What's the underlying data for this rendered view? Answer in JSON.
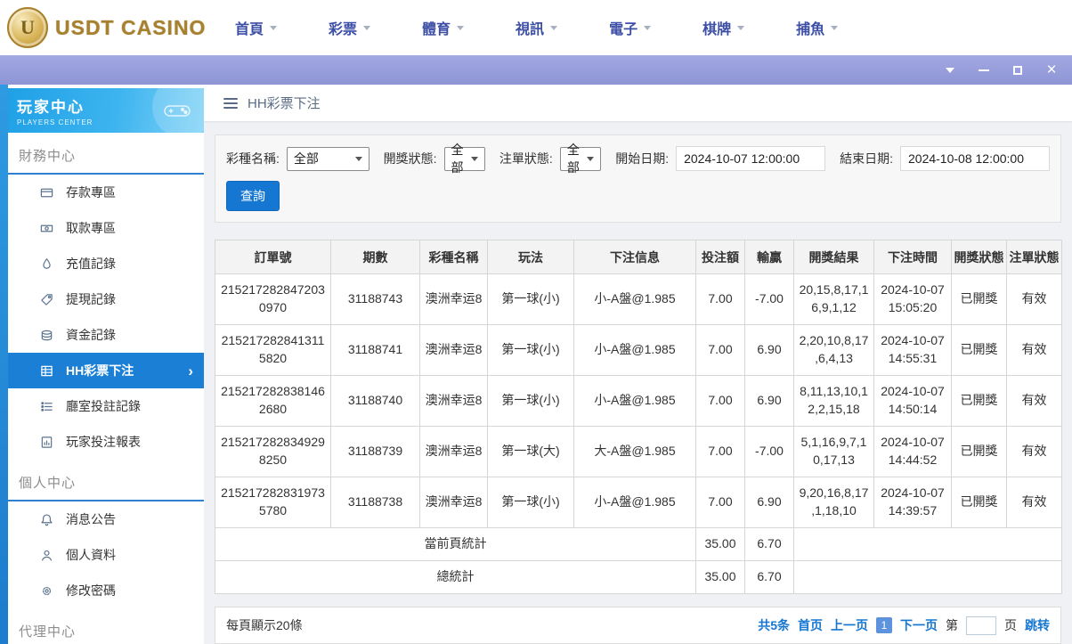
{
  "brand": {
    "name": "USDT CASINO",
    "coin_letter": "U"
  },
  "top_nav": {
    "caret_icon": "chevron-down-icon",
    "items": [
      {
        "label": "首頁"
      },
      {
        "label": "彩票"
      },
      {
        "label": "體育"
      },
      {
        "label": "視訊"
      },
      {
        "label": "電子"
      },
      {
        "label": "棋牌"
      },
      {
        "label": "捕魚"
      }
    ]
  },
  "window_controls": {
    "icons": [
      "collapse-chevron",
      "minimize",
      "maximize",
      "close"
    ],
    "close_glyph": "×"
  },
  "sidebar": {
    "header": {
      "title": "玩家中心",
      "subtitle": "PLAYERS CENTER",
      "icon": "gamepad-icon"
    },
    "sections": [
      {
        "title": "財務中心",
        "items": [
          {
            "label": "存款專區",
            "icon": "deposit-icon"
          },
          {
            "label": "取款專區",
            "icon": "withdraw-icon"
          },
          {
            "label": "充值記錄",
            "icon": "recharge-icon"
          },
          {
            "label": "提現記錄",
            "icon": "cashout-icon"
          },
          {
            "label": "資金記錄",
            "icon": "funds-icon"
          },
          {
            "label": "HH彩票下注",
            "icon": "lottery-icon",
            "active": true,
            "arrow": "›"
          },
          {
            "label": "廳室投註記錄",
            "icon": "hall-records-icon"
          },
          {
            "label": "玩家投注報表",
            "icon": "report-icon"
          }
        ]
      },
      {
        "title": "個人中心",
        "items": [
          {
            "label": "消息公告",
            "icon": "bell-icon"
          },
          {
            "label": "個人資料",
            "icon": "user-icon"
          },
          {
            "label": "修改密碼",
            "icon": "gear-icon"
          }
        ]
      },
      {
        "title": "代理中心",
        "items": []
      }
    ]
  },
  "breadcrumb": {
    "title": "HH彩票下注",
    "icon": "hamburger-icon"
  },
  "filters": {
    "lottery_label": "彩種名稱:",
    "lottery_value": "全部",
    "draw_status_label": "開獎狀態:",
    "draw_status_value": "全部",
    "order_status_label": "注單狀態:",
    "order_status_value": "全部",
    "start_label": "開始日期:",
    "start_value": "2024-10-07 12:00:00",
    "end_label": "結束日期:",
    "end_value": "2024-10-08 12:00:00",
    "search_label": "查詢"
  },
  "table": {
    "headers": [
      "訂單號",
      "期數",
      "彩種名稱",
      "玩法",
      "下注信息",
      "投注額",
      "輸贏",
      "開獎結果",
      "下注時間",
      "開獎狀態",
      "注單狀態"
    ],
    "rows": [
      {
        "order_no": "2152172828472030970",
        "period": "31188743",
        "lottery": "澳洲幸运8",
        "play": "第一球(小)",
        "bet_info": "小-A盤@1.985",
        "amount": "7.00",
        "win": "-7.00",
        "result": "20,15,8,17,16,9,1,12",
        "time": "2024-10-07 15:05:20",
        "draw_status": "已開獎",
        "order_status": "有效"
      },
      {
        "order_no": "2152172828413115820",
        "period": "31188741",
        "lottery": "澳洲幸运8",
        "play": "第一球(小)",
        "bet_info": "小-A盤@1.985",
        "amount": "7.00",
        "win": "6.90",
        "result": "2,20,10,8,17,6,4,13",
        "time": "2024-10-07 14:55:31",
        "draw_status": "已開獎",
        "order_status": "有效"
      },
      {
        "order_no": "2152172828381462680",
        "period": "31188740",
        "lottery": "澳洲幸运8",
        "play": "第一球(小)",
        "bet_info": "小-A盤@1.985",
        "amount": "7.00",
        "win": "6.90",
        "result": "8,11,13,10,12,2,15,18",
        "time": "2024-10-07 14:50:14",
        "draw_status": "已開獎",
        "order_status": "有效"
      },
      {
        "order_no": "2152172828349298250",
        "period": "31188739",
        "lottery": "澳洲幸运8",
        "play": "第一球(大)",
        "bet_info": "大-A盤@1.985",
        "amount": "7.00",
        "win": "-7.00",
        "result": "5,1,16,9,7,10,17,13",
        "time": "2024-10-07 14:44:52",
        "draw_status": "已開獎",
        "order_status": "有效"
      },
      {
        "order_no": "2152172828319735780",
        "period": "31188738",
        "lottery": "澳洲幸运8",
        "play": "第一球(小)",
        "bet_info": "小-A盤@1.985",
        "amount": "7.00",
        "win": "6.90",
        "result": "9,20,16,8,17,1,18,10",
        "time": "2024-10-07 14:39:57",
        "draw_status": "已開獎",
        "order_status": "有效"
      }
    ],
    "page_total": {
      "label": "當前頁統計",
      "amount": "35.00",
      "win": "6.70"
    },
    "grand_total": {
      "label": "總統計",
      "amount": "35.00",
      "win": "6.70"
    }
  },
  "pagination": {
    "page_size": "每頁顯示20條",
    "total": "共5条",
    "first": "首页",
    "prev": "上一页",
    "current": "1",
    "next": "下一页",
    "jump_prefix": "第",
    "jump_suffix": "页",
    "jump_label": "跳转"
  },
  "colors": {
    "accent": "#1b7fd6",
    "link": "#1677d3",
    "nav_text": "#3c4ea5",
    "gold": "#a8812e",
    "titlebar_purple": "#989fdb",
    "sidebar_header": "#1fa0e6"
  }
}
